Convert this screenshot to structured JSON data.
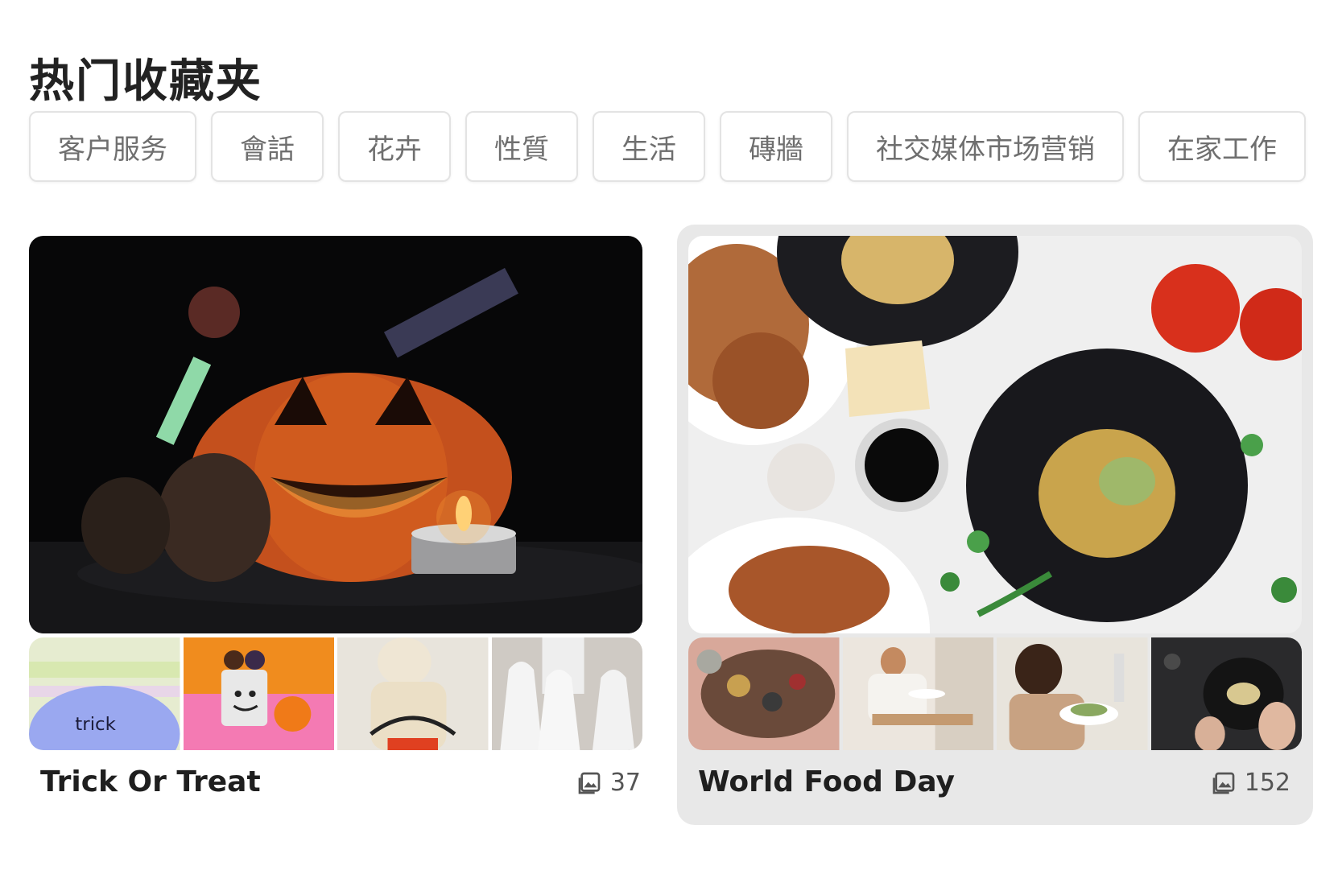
{
  "header": {
    "title": "热门收藏夹"
  },
  "tags": [
    {
      "label": "客户服务"
    },
    {
      "label": "會話"
    },
    {
      "label": "花卉"
    },
    {
      "label": "性質"
    },
    {
      "label": "生活"
    },
    {
      "label": "磚牆"
    },
    {
      "label": "社交媒体市场营销"
    },
    {
      "label": "在家工作"
    }
  ],
  "collections": [
    {
      "title": "Trick Or Treat",
      "count": "37",
      "count_icon": "gallery-icon",
      "hovered": false,
      "main_image": "halloween-pumpkin-candle",
      "thumbnails": [
        "blue-pumpkin-trick-or-treat",
        "tin-can-ghost-and-pumpkin",
        "mummy-costume",
        "sheet-ghosts"
      ]
    },
    {
      "title": "World Food Day",
      "count": "152",
      "count_icon": "gallery-icon",
      "hovered": true,
      "main_image": "food-spread-pasta-chicken",
      "thumbnails": [
        "grazing-board",
        "woman-eating-in-kitchen",
        "woman-eating-salad",
        "cooking-in-pan"
      ]
    }
  ],
  "colors": {
    "hover_card_bg": "#e8e8e8",
    "tag_border": "#e3e3e3",
    "tag_text": "#6f6f6f"
  }
}
